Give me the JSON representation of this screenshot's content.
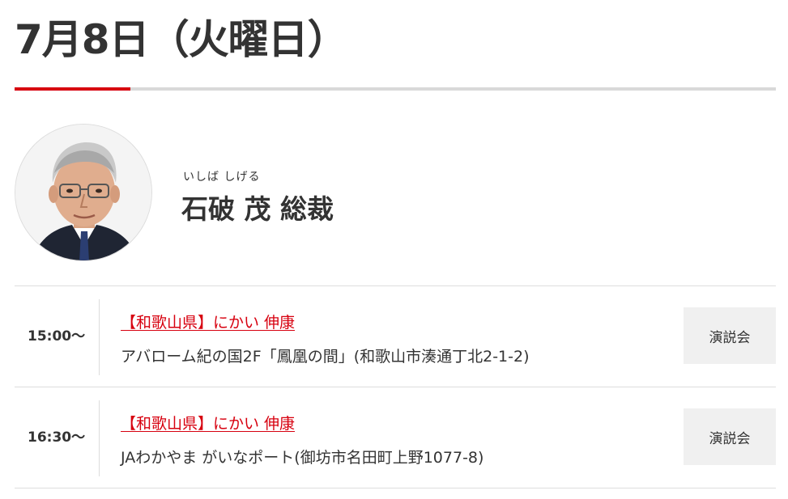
{
  "page": {
    "date_title": "7月8日（火曜日）"
  },
  "profile": {
    "ruby": "いしば しげる",
    "name": "石破 茂 総裁",
    "photo_alt": "石破 茂"
  },
  "schedule": [
    {
      "time": "15:00〜",
      "link_text": "【和歌山県】にかい 伸康",
      "place": "アバローム紀の国2F「鳳凰の間」(和歌山市湊通丁北2-1-2)",
      "category": "演説会"
    },
    {
      "time": "16:30〜",
      "link_text": "【和歌山県】にかい 伸康",
      "place": "JAわかやま がいなポート(御坊市名田町上野1077-8)",
      "category": "演説会"
    }
  ],
  "colors": {
    "accent_red": "#d7000f",
    "text": "#333333",
    "badge_bg": "#f0f0f0",
    "rule_gray": "#d9d9d9"
  }
}
